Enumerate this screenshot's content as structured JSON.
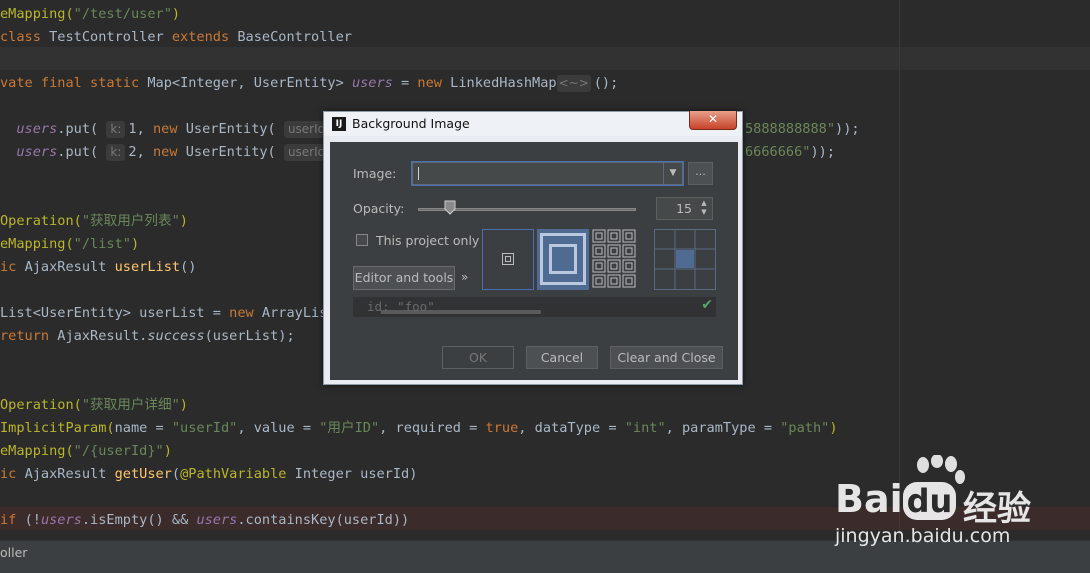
{
  "editor": {
    "lines": [
      "eMapping(\"/test/user\")",
      "class TestController extends BaseController",
      "",
      "vate final static Map<Integer, UserEntity> users = new LinkedHashMap<~>();",
      "",
      "users.put( k: 1, new UserEntity( userId: 1, ... \"5888888888\"));",
      "users.put( k: 2, new UserEntity( userId: 2, ... \"6666666\"));",
      "",
      "",
      "Operation(\"获取用户列表\")",
      "eMapping(\"/list\")",
      "ic AjaxResult userList()",
      "",
      "List<UserEntity> userList = new ArrayLis",
      "return AjaxResult.success(userList);",
      "",
      "",
      "Operation(\"获取用户详细\")",
      "ImplicitParam(name = \"userId\", value = \"用户ID\", required = true, dataType = \"int\", paramType = \"path\")",
      "eMapping(\"/{userId}\")",
      "ic AjaxResult getUser(@PathVariable Integer userId)",
      "",
      "if (!users.isEmpty() && users.containsKey(userId))"
    ]
  },
  "statusbar": {
    "text": "oller"
  },
  "dialog": {
    "title": "Background Image",
    "close_label": "✕",
    "image_label": "Image:",
    "image_value": "",
    "browse_label": "...",
    "opacity_label": "Opacity:",
    "opacity_value": "15",
    "opacity_level": 0.15,
    "this_project_label": "This project only",
    "editor_tools_label": "Editor and tools",
    "more_label": "»",
    "preview_code": "id: \"foo\"",
    "ok_label": "OK",
    "cancel_label": "Cancel",
    "clear_close_label": "Clear and Close"
  },
  "icons": {
    "app": "intellij-icon",
    "combo": "chevron-down-icon",
    "check": "checkmark-icon"
  },
  "colors": {
    "editor_bg": "#2b2b2b",
    "keyword": "#cc7832",
    "annotation": "#bbb529",
    "string": "#6a8759",
    "field": "#9876aa",
    "method": "#ffc66d",
    "dialog_content": "#3c3f41",
    "selection_blue": "#4b6eaf"
  },
  "watermark": {
    "brand": "Bai",
    "brand2": "du",
    "cn": "经验",
    "url": "jingyan.baidu.com"
  }
}
